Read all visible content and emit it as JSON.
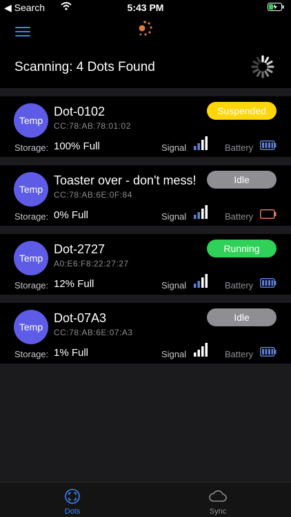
{
  "status_bar": {
    "back_label": "◀ Search",
    "time": "5:43 PM"
  },
  "nav": {
    "menu_icon": "hamburger-icon",
    "logo_icon": "dots-logo-icon"
  },
  "header": {
    "title": "Scanning: 4 Dots Found"
  },
  "labels": {
    "storage": "Storage:",
    "signal": "Signal",
    "battery": "Battery"
  },
  "colors": {
    "accent": "#3a86ff",
    "avatar": "#5e5ce6",
    "suspended": "#ffd60a",
    "running": "#30d158",
    "idle": "#8e8e93",
    "battery_ok": "#5f7fd6",
    "battery_low": "#e07a5f"
  },
  "devices": [
    {
      "avatar": "Temp",
      "name": "Dot-0102",
      "mac": "CC:78:AB:78:01:02",
      "status": "Suspended",
      "storage": "100% Full",
      "signal_bars": 4,
      "battery": "full"
    },
    {
      "avatar": "Temp",
      "name": "Toaster over - don't mess!",
      "mac": "CC:78:AB:6E:0F:84",
      "status": "Idle",
      "storage": "0% Full",
      "signal_bars": 4,
      "battery": "low"
    },
    {
      "avatar": "Temp",
      "name": "Dot-2727",
      "mac": "A0:E6:F8:22:27:27",
      "status": "Running",
      "storage": "12% Full",
      "signal_bars": 4,
      "battery": "full"
    },
    {
      "avatar": "Temp",
      "name": "Dot-07A3",
      "mac": "CC:78:AB:6E:07:A3",
      "status": "Idle",
      "storage": "1% Full",
      "signal_bars": 4,
      "battery": "full"
    }
  ],
  "tabs": [
    {
      "label": "Dots",
      "icon": "scan-icon",
      "active": true
    },
    {
      "label": "Sync",
      "icon": "cloud-icon",
      "active": false
    }
  ]
}
